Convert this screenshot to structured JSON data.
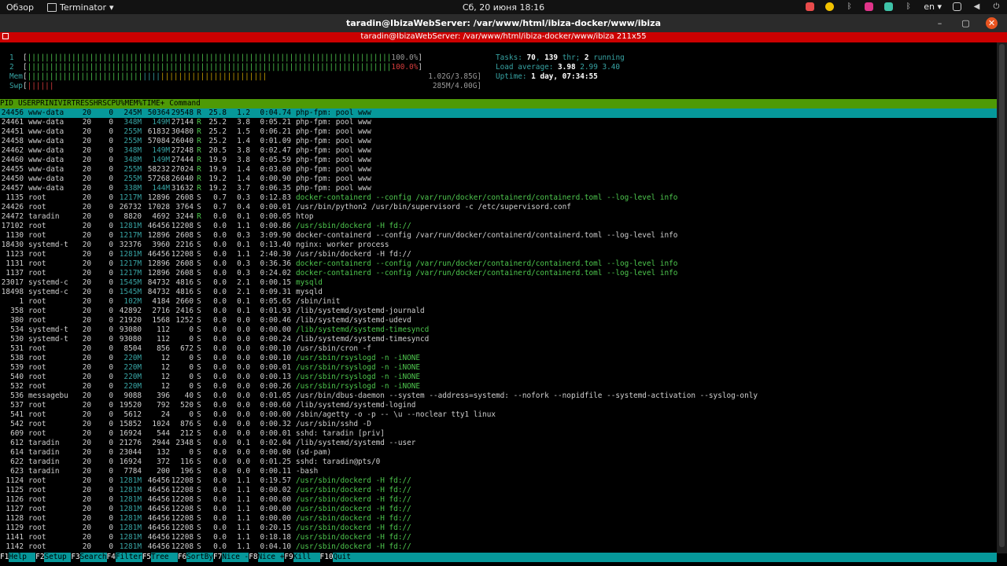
{
  "topbar": {
    "overview": "Обзор",
    "app": "Terminator",
    "app_arrow": "▾",
    "clock": "Сб, 20 июня  18:16",
    "lang": "en",
    "lang_arrow": "▾"
  },
  "window": {
    "title": "taradin@IbizaWebServer: /var/www/html/ibiza-docker/www/ibiza",
    "minimize": "–",
    "maximize": "▢",
    "close": "✕"
  },
  "terminal_bar": {
    "title": "taradin@IbizaWebServer: /var/www/html/ibiza-docker/www/ibiza 211x55"
  },
  "meters": {
    "cpu1": {
      "label": "1",
      "value": "100.0%"
    },
    "cpu2": {
      "label": "2",
      "value": "100.0%"
    },
    "mem": {
      "label": "Mem",
      "value": "1.02G/3.85G"
    },
    "swp": {
      "label": "Swp",
      "value": "285M/4.00G"
    },
    "tasks_label": "Tasks: ",
    "tasks_val": "70",
    "tasks_thr": "139",
    "tasks_run": "2",
    "tasks_sep1": ", ",
    "tasks_thr_label": " thr; ",
    "tasks_run_label": " running",
    "load_label": "Load average: ",
    "load1": "3.98",
    "load5": "2.99",
    "load15": "3.40",
    "uptime_label": "Uptime: ",
    "uptime": "1 day, 07:34:55"
  },
  "columns": [
    "PID",
    "USER",
    "PRI",
    "NI",
    "VIRT",
    "RES",
    "SHR",
    "S",
    "CPU%",
    "MEM%",
    "TIME+",
    "Command"
  ],
  "processes": [
    [
      "24456",
      "www-data",
      "20",
      "0",
      "245M",
      "50364",
      "29548",
      "R",
      "25.8",
      "1.2",
      "0:04.74",
      "php-fpm: pool www"
    ],
    [
      "24461",
      "www-data",
      "20",
      "0",
      "348M",
      "149M",
      "27144",
      "R",
      "25.2",
      "3.8",
      "0:05.21",
      "php-fpm: pool www"
    ],
    [
      "24451",
      "www-data",
      "20",
      "0",
      "255M",
      "61832",
      "30480",
      "R",
      "25.2",
      "1.5",
      "0:06.21",
      "php-fpm: pool www"
    ],
    [
      "24458",
      "www-data",
      "20",
      "0",
      "255M",
      "57084",
      "26040",
      "R",
      "25.2",
      "1.4",
      "0:01.09",
      "php-fpm: pool www"
    ],
    [
      "24462",
      "www-data",
      "20",
      "0",
      "348M",
      "149M",
      "27248",
      "R",
      "20.5",
      "3.8",
      "0:02.47",
      "php-fpm: pool www"
    ],
    [
      "24460",
      "www-data",
      "20",
      "0",
      "348M",
      "149M",
      "27444",
      "R",
      "19.9",
      "3.8",
      "0:05.59",
      "php-fpm: pool www"
    ],
    [
      "24455",
      "www-data",
      "20",
      "0",
      "255M",
      "58232",
      "27024",
      "R",
      "19.9",
      "1.4",
      "0:03.00",
      "php-fpm: pool www"
    ],
    [
      "24450",
      "www-data",
      "20",
      "0",
      "255M",
      "57268",
      "26040",
      "R",
      "19.2",
      "1.4",
      "0:00.90",
      "php-fpm: pool www"
    ],
    [
      "24457",
      "www-data",
      "20",
      "0",
      "338M",
      "144M",
      "31632",
      "R",
      "19.2",
      "3.7",
      "0:06.35",
      "php-fpm: pool www"
    ],
    [
      "1135",
      "root",
      "20",
      "0",
      "1217M",
      "12896",
      "2608",
      "S",
      "0.7",
      "0.3",
      "0:12.83",
      "docker-containerd --config /var/run/docker/containerd/containerd.toml --log-level info"
    ],
    [
      "24426",
      "root",
      "20",
      "0",
      "26732",
      "17028",
      "3764",
      "S",
      "0.7",
      "0.4",
      "0:00.01",
      "/usr/bin/python2 /usr/bin/supervisord -c /etc/supervisord.conf"
    ],
    [
      "24472",
      "taradin",
      "20",
      "0",
      "8820",
      "4692",
      "3244",
      "R",
      "0.0",
      "0.1",
      "0:00.05",
      "htop"
    ],
    [
      "17102",
      "root",
      "20",
      "0",
      "1281M",
      "46456",
      "12208",
      "S",
      "0.0",
      "1.1",
      "0:00.86",
      "/usr/sbin/dockerd -H fd://"
    ],
    [
      "1130",
      "root",
      "20",
      "0",
      "1217M",
      "12896",
      "2608",
      "S",
      "0.0",
      "0.3",
      "3:09.90",
      "docker-containerd --config /var/run/docker/containerd/containerd.toml --log-level info"
    ],
    [
      "18430",
      "systemd-t",
      "20",
      "0",
      "32376",
      "3960",
      "2216",
      "S",
      "0.0",
      "0.1",
      "0:13.40",
      "nginx: worker process"
    ],
    [
      "1123",
      "root",
      "20",
      "0",
      "1281M",
      "46456",
      "12208",
      "S",
      "0.0",
      "1.1",
      "2:40.30",
      "/usr/sbin/dockerd -H fd://"
    ],
    [
      "1131",
      "root",
      "20",
      "0",
      "1217M",
      "12896",
      "2608",
      "S",
      "0.0",
      "0.3",
      "0:36.36",
      "docker-containerd --config /var/run/docker/containerd/containerd.toml --log-level info"
    ],
    [
      "1137",
      "root",
      "20",
      "0",
      "1217M",
      "12896",
      "2608",
      "S",
      "0.0",
      "0.3",
      "0:24.02",
      "docker-containerd --config /var/run/docker/containerd/containerd.toml --log-level info"
    ],
    [
      "23017",
      "systemd-c",
      "20",
      "0",
      "1545M",
      "84732",
      "4816",
      "S",
      "0.0",
      "2.1",
      "0:00.15",
      "mysqld"
    ],
    [
      "18498",
      "systemd-c",
      "20",
      "0",
      "1545M",
      "84732",
      "4816",
      "S",
      "0.0",
      "2.1",
      "0:09.31",
      "mysqld"
    ],
    [
      "1",
      "root",
      "20",
      "0",
      "102M",
      "4184",
      "2660",
      "S",
      "0.0",
      "0.1",
      "0:05.65",
      "/sbin/init"
    ],
    [
      "358",
      "root",
      "20",
      "0",
      "42892",
      "2716",
      "2416",
      "S",
      "0.0",
      "0.1",
      "0:01.93",
      "/lib/systemd/systemd-journald"
    ],
    [
      "380",
      "root",
      "20",
      "0",
      "21920",
      "1568",
      "1252",
      "S",
      "0.0",
      "0.0",
      "0:00.46",
      "/lib/systemd/systemd-udevd"
    ],
    [
      "534",
      "systemd-t",
      "20",
      "0",
      "93080",
      "112",
      "0",
      "S",
      "0.0",
      "0.0",
      "0:00.00",
      "/lib/systemd/systemd-timesyncd"
    ],
    [
      "530",
      "systemd-t",
      "20",
      "0",
      "93080",
      "112",
      "0",
      "S",
      "0.0",
      "0.0",
      "0:00.24",
      "/lib/systemd/systemd-timesyncd"
    ],
    [
      "531",
      "root",
      "20",
      "0",
      "8504",
      "856",
      "672",
      "S",
      "0.0",
      "0.0",
      "0:00.10",
      "/usr/sbin/cron -f"
    ],
    [
      "538",
      "root",
      "20",
      "0",
      "220M",
      "12",
      "0",
      "S",
      "0.0",
      "0.0",
      "0:00.10",
      "/usr/sbin/rsyslogd -n -iNONE"
    ],
    [
      "539",
      "root",
      "20",
      "0",
      "220M",
      "12",
      "0",
      "S",
      "0.0",
      "0.0",
      "0:00.01",
      "/usr/sbin/rsyslogd -n -iNONE"
    ],
    [
      "540",
      "root",
      "20",
      "0",
      "220M",
      "12",
      "0",
      "S",
      "0.0",
      "0.0",
      "0:00.13",
      "/usr/sbin/rsyslogd -n -iNONE"
    ],
    [
      "532",
      "root",
      "20",
      "0",
      "220M",
      "12",
      "0",
      "S",
      "0.0",
      "0.0",
      "0:00.26",
      "/usr/sbin/rsyslogd -n -iNONE"
    ],
    [
      "536",
      "messagebu",
      "20",
      "0",
      "9088",
      "396",
      "40",
      "S",
      "0.0",
      "0.0",
      "0:01.05",
      "/usr/bin/dbus-daemon --system --address=systemd: --nofork --nopidfile --systemd-activation --syslog-only"
    ],
    [
      "537",
      "root",
      "20",
      "0",
      "19520",
      "792",
      "520",
      "S",
      "0.0",
      "0.0",
      "0:00.60",
      "/lib/systemd/systemd-logind"
    ],
    [
      "541",
      "root",
      "20",
      "0",
      "5612",
      "24",
      "0",
      "S",
      "0.0",
      "0.0",
      "0:00.00",
      "/sbin/agetty -o -p -- \\u --noclear tty1 linux"
    ],
    [
      "542",
      "root",
      "20",
      "0",
      "15852",
      "1024",
      "876",
      "S",
      "0.0",
      "0.0",
      "0:00.32",
      "/usr/sbin/sshd -D"
    ],
    [
      "609",
      "root",
      "20",
      "0",
      "16924",
      "544",
      "212",
      "S",
      "0.0",
      "0.0",
      "0:00.01",
      "sshd: taradin [priv]"
    ],
    [
      "612",
      "taradin",
      "20",
      "0",
      "21276",
      "2944",
      "2348",
      "S",
      "0.0",
      "0.1",
      "0:02.04",
      "/lib/systemd/systemd --user"
    ],
    [
      "614",
      "taradin",
      "20",
      "0",
      "23044",
      "132",
      "0",
      "S",
      "0.0",
      "0.0",
      "0:00.00",
      "(sd-pam)"
    ],
    [
      "622",
      "taradin",
      "20",
      "0",
      "16924",
      "372",
      "116",
      "S",
      "0.0",
      "0.0",
      "0:01.25",
      "sshd: taradin@pts/0"
    ],
    [
      "623",
      "taradin",
      "20",
      "0",
      "7784",
      "200",
      "196",
      "S",
      "0.0",
      "0.0",
      "0:00.11",
      "-bash"
    ],
    [
      "1124",
      "root",
      "20",
      "0",
      "1281M",
      "46456",
      "12208",
      "S",
      "0.0",
      "1.1",
      "0:19.57",
      "/usr/sbin/dockerd -H fd://"
    ],
    [
      "1125",
      "root",
      "20",
      "0",
      "1281M",
      "46456",
      "12208",
      "S",
      "0.0",
      "1.1",
      "0:00.02",
      "/usr/sbin/dockerd -H fd://"
    ],
    [
      "1126",
      "root",
      "20",
      "0",
      "1281M",
      "46456",
      "12208",
      "S",
      "0.0",
      "1.1",
      "0:00.00",
      "/usr/sbin/dockerd -H fd://"
    ],
    [
      "1127",
      "root",
      "20",
      "0",
      "1281M",
      "46456",
      "12208",
      "S",
      "0.0",
      "1.1",
      "0:00.00",
      "/usr/sbin/dockerd -H fd://"
    ],
    [
      "1128",
      "root",
      "20",
      "0",
      "1281M",
      "46456",
      "12208",
      "S",
      "0.0",
      "1.1",
      "0:00.00",
      "/usr/sbin/dockerd -H fd://"
    ],
    [
      "1129",
      "root",
      "20",
      "0",
      "1281M",
      "46456",
      "12208",
      "S",
      "0.0",
      "1.1",
      "0:20.15",
      "/usr/sbin/dockerd -H fd://"
    ],
    [
      "1141",
      "root",
      "20",
      "0",
      "1281M",
      "46456",
      "12208",
      "S",
      "0.0",
      "1.1",
      "0:18.18",
      "/usr/sbin/dockerd -H fd://"
    ],
    [
      "1142",
      "root",
      "20",
      "0",
      "1281M",
      "46456",
      "12208",
      "S",
      "0.0",
      "1.1",
      "0:04.10",
      "/usr/sbin/dockerd -H fd://"
    ]
  ],
  "green_cmd_rows": [
    9,
    12,
    16,
    17,
    18,
    23,
    26,
    27,
    28,
    29,
    39,
    40,
    41,
    42,
    43,
    44,
    45,
    46
  ],
  "footer": [
    {
      "key": "F1",
      "label": "Help  "
    },
    {
      "key": "F2",
      "label": "Setup "
    },
    {
      "key": "F3",
      "label": "Search"
    },
    {
      "key": "F4",
      "label": "Filter"
    },
    {
      "key": "F5",
      "label": "Tree  "
    },
    {
      "key": "F6",
      "label": "SortBy"
    },
    {
      "key": "F7",
      "label": "Nice -"
    },
    {
      "key": "F8",
      "label": "Nice +"
    },
    {
      "key": "F9",
      "label": "Kill  "
    },
    {
      "key": "F10",
      "label": "Quit"
    }
  ],
  "colors": {
    "header_bg": "#4e9a06",
    "selected_bg": "#06989a",
    "bar_red": "#cc0000"
  }
}
